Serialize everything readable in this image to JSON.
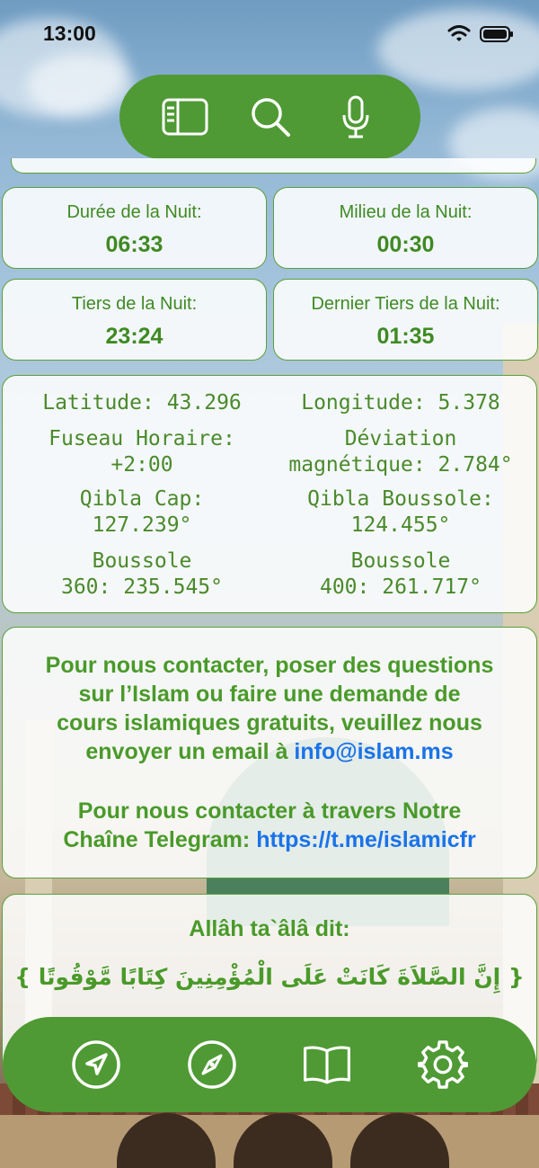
{
  "status_bar": {
    "time": "13:00"
  },
  "top_toolbar": {
    "icons": [
      "sidebar-icon",
      "search-icon",
      "microphone-icon"
    ]
  },
  "night_info": {
    "duration_label": "Durée de la Nuit:",
    "duration_value": "06:33",
    "middle_label": "Milieu de la Nuit:",
    "middle_value": "00:30",
    "third_label": "Tiers de la Nuit:",
    "third_value": "23:24",
    "last_third_label": "Dernier Tiers de la Nuit:",
    "last_third_value": "01:35"
  },
  "coordinates": {
    "latitude": "Latitude:  43.296",
    "longitude": "Longitude:  5.378",
    "timezone_line1": "Fuseau Horaire:",
    "timezone_line2": "+2:00",
    "deviation_line1": "Déviation",
    "deviation_line2": "magnétique:  2.784°",
    "qibla_cap_line1": "Qibla Cap:",
    "qibla_cap_line2": "127.239°",
    "qibla_compass_line1": "Qibla Boussole:",
    "qibla_compass_line2": "124.455°",
    "compass360_line1": "Boussole",
    "compass360_line2": "360:  235.545°",
    "compass400_line1": "Boussole",
    "compass400_line2": "400:  261.717°"
  },
  "contact": {
    "line1": "Pour nous contacter, poser des questions",
    "line2": "sur l’Islam ou faire une demande de",
    "line3": "cours islamiques gratuits, veuillez nous",
    "line4": "envoyer un email à ",
    "email": "info@islam.ms",
    "line5": "Pour nous contacter à travers Notre",
    "line6": "Chaîne Telegram: ",
    "telegram_link": "https://t.me/islamicfr"
  },
  "quote": {
    "title": "Allâh ta`âlâ dit:",
    "arabic": "{ إِنَّ الصَّلاَةَ كَانَتْ عَلَى الْمُؤْمِنِينَ كِتَابًا مَّوْقُوتًا }"
  },
  "tab_bar": {
    "icons": [
      "location-arrow-icon",
      "compass-icon",
      "book-icon",
      "settings-gear-icon"
    ]
  },
  "colors": {
    "accent": "#4f9a34",
    "text_green": "#4a9a2a",
    "link": "#1a73e8"
  }
}
